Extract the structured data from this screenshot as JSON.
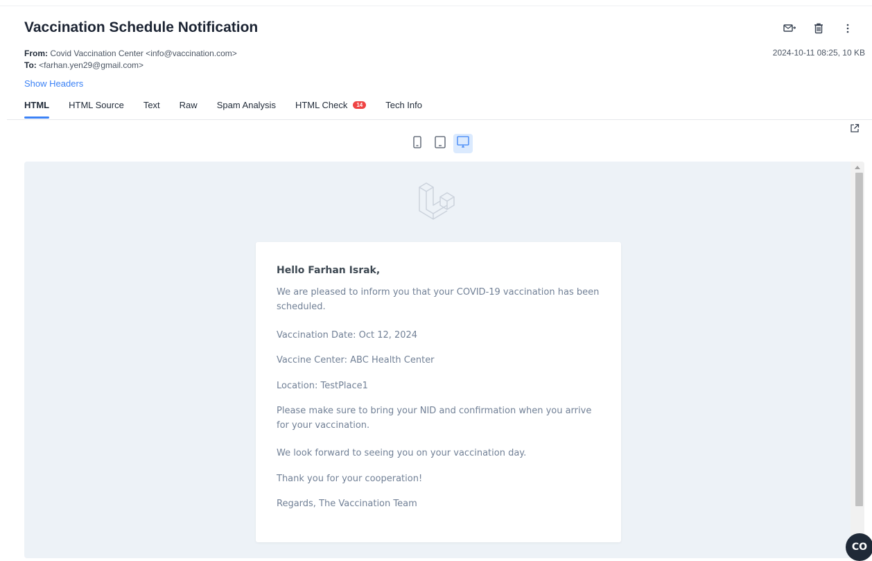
{
  "email": {
    "subject": "Vaccination Schedule Notification",
    "from_label": "From:",
    "from_value": "Covid Vaccination Center <info@vaccination.com>",
    "to_label": "To:",
    "to_value": "<farhan.yen29@gmail.com>",
    "date_size": "2024-10-11 08:25, 10 KB",
    "show_headers": "Show Headers"
  },
  "tabs": [
    {
      "label": "HTML",
      "active": true
    },
    {
      "label": "HTML Source"
    },
    {
      "label": "Text"
    },
    {
      "label": "Raw"
    },
    {
      "label": "Spam Analysis"
    },
    {
      "label": "HTML Check",
      "badge": "14"
    },
    {
      "label": "Tech Info"
    }
  ],
  "actions": [
    "forward-mail-icon",
    "trash-icon",
    "more-vertical-icon"
  ],
  "devices": [
    "mobile-icon",
    "tablet-icon",
    "desktop-icon"
  ],
  "selected_device": "desktop",
  "body": {
    "greeting": "Hello Farhan Israk,",
    "paragraphs": [
      "We are pleased to inform you that your COVID-19 vaccination has been scheduled.",
      "Vaccination Date: Oct 12, 2024",
      "Vaccine Center: ABC Health Center",
      "Location: TestPlace1",
      "Please make sure to bring your NID and confirmation when you arrive for your vaccination.",
      "We look forward to seeing you on your vaccination day.",
      "Thank you for your cooperation!",
      "Regards, The Vaccination Team"
    ]
  },
  "chat_widget": {
    "label": "CO"
  },
  "colors": {
    "accent": "#3b82f6",
    "badge": "#ef4444",
    "preview_bg": "#edf2f7",
    "body_text": "#718096"
  }
}
